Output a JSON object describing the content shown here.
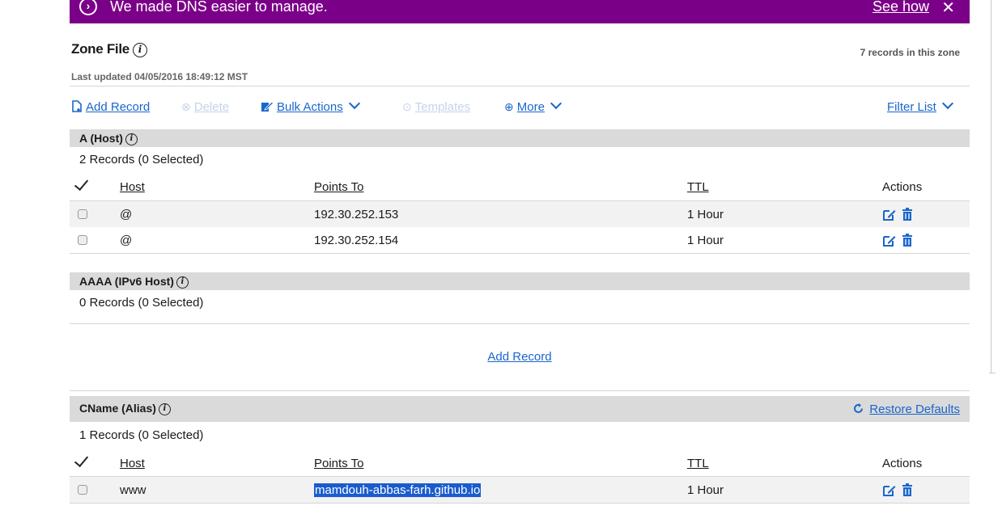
{
  "banner": {
    "message": "We made DNS easier to manage.",
    "link": "See how",
    "close": "✕",
    "bg": "#7b0088"
  },
  "zone": {
    "title": "Zone File",
    "records_in_zone": "7 records in this zone",
    "last_updated": "Last updated 04/05/2016 18:49:12 MST"
  },
  "toolbar": {
    "add_record": "Add Record",
    "delete": "Delete",
    "bulk_actions": "Bulk Actions",
    "templates": "Templates",
    "more": "More",
    "filter_list": "Filter List"
  },
  "columns": {
    "host": "Host",
    "points_to": "Points To",
    "ttl": "TTL",
    "actions": "Actions"
  },
  "sections": {
    "a": {
      "title": "A (Host)",
      "count": "2 Records (0 Selected)",
      "rows": [
        {
          "host": "@",
          "points_to": "192.30.252.153",
          "ttl": "1 Hour"
        },
        {
          "host": "@",
          "points_to": "192.30.252.154",
          "ttl": "1 Hour"
        }
      ]
    },
    "aaaa": {
      "title": "AAAA (IPv6 Host)",
      "count": "0 Records (0 Selected)",
      "add_record": "Add Record"
    },
    "cname": {
      "title": "CName (Alias)",
      "restore": "Restore Defaults",
      "count": "1 Records (0 Selected)",
      "rows": [
        {
          "host": "www",
          "points_to": "mamdouh-abbas-farh.github.io",
          "ttl": "1 Hour"
        }
      ]
    }
  },
  "colors": {
    "link": "#1a66cc",
    "header_bg": "#dadada",
    "selection": "#1a5ccd"
  },
  "icons": [
    "chevron-right-circle-icon",
    "close-icon",
    "info-icon",
    "add-record-icon",
    "delete-icon",
    "bulk-actions-icon",
    "templates-icon",
    "plus-circle-icon",
    "chevron-down-icon",
    "checkmark-icon",
    "edit-icon",
    "trash-icon",
    "refresh-icon"
  ]
}
